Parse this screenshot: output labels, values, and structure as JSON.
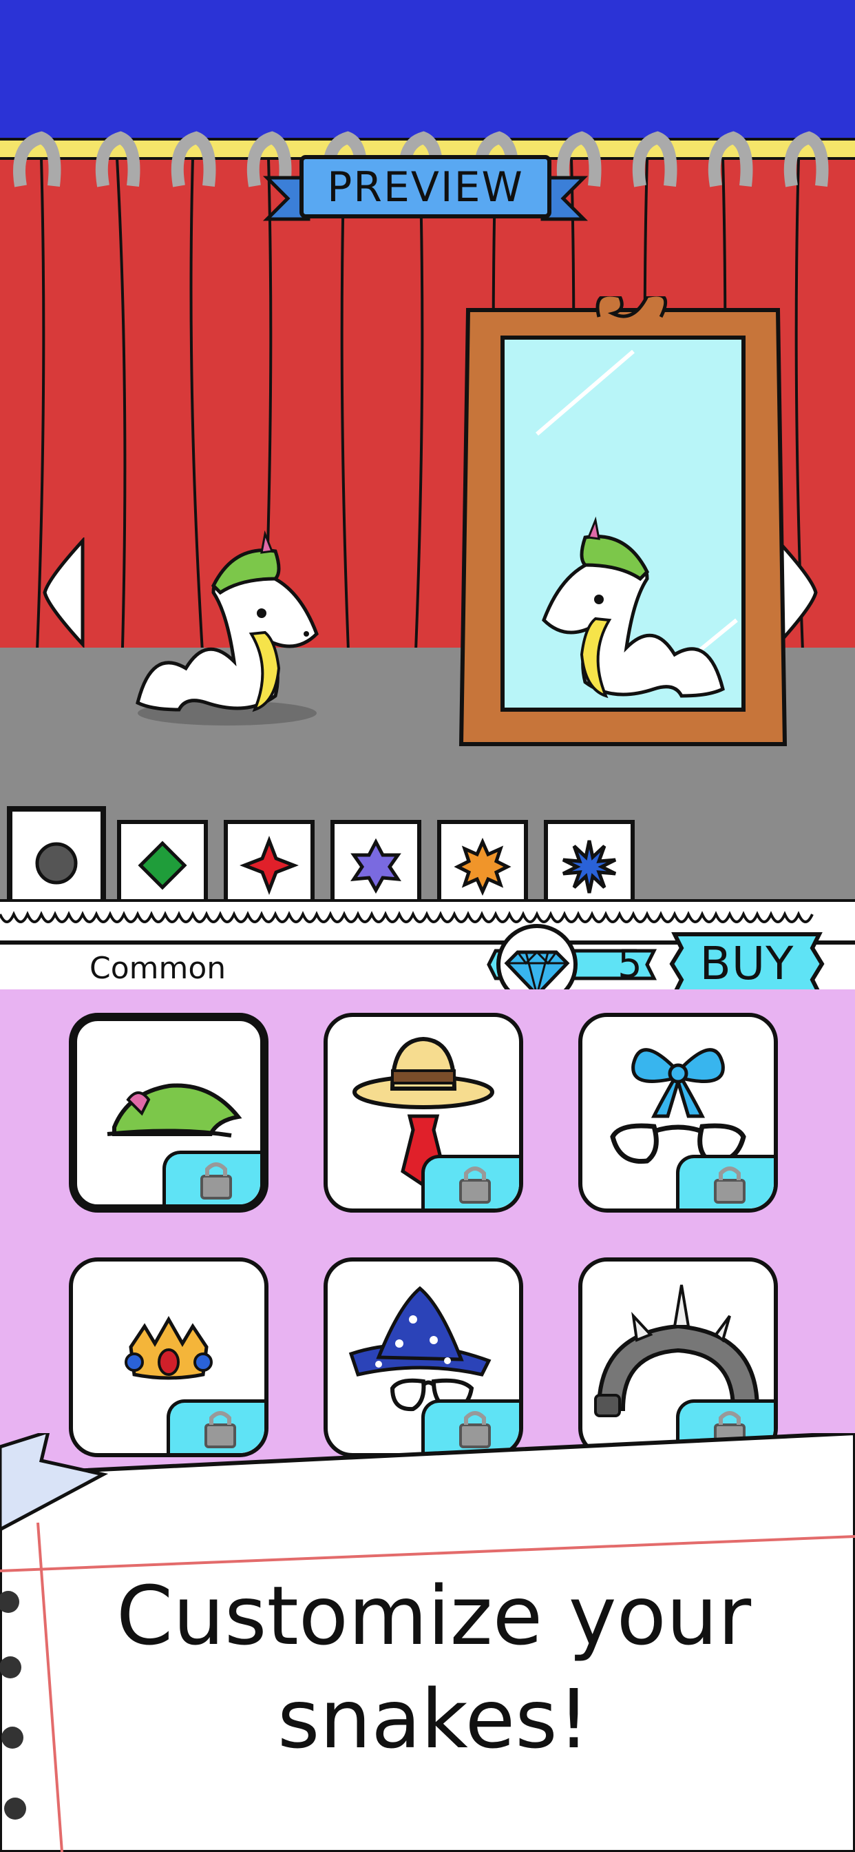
{
  "preview": {
    "title": "PREVIEW"
  },
  "rarity_tabs": [
    {
      "name": "circle",
      "color": "#555555"
    },
    {
      "name": "diamond",
      "color": "#1f9d3a"
    },
    {
      "name": "star4",
      "color": "#e0202a"
    },
    {
      "name": "star6",
      "color": "#7a6ae0"
    },
    {
      "name": "star8",
      "color": "#f0952a"
    },
    {
      "name": "star12",
      "color": "#2a62d8"
    }
  ],
  "shop": {
    "rarity_label": "Common",
    "price": "5",
    "currency_icon": "diamond-gem-icon",
    "buy_label": "BUY"
  },
  "items": [
    {
      "name": "green-feather-hat",
      "locked": true
    },
    {
      "name": "straw-hat-and-tie",
      "locked": true
    },
    {
      "name": "blue-bow-and-glasses",
      "locked": true
    },
    {
      "name": "small-crown",
      "locked": true
    },
    {
      "name": "wizard-hat-and-glasses",
      "locked": true
    },
    {
      "name": "spiked-headband",
      "locked": true
    }
  ],
  "headline": {
    "line1": "Customize your",
    "line2": "snakes!"
  },
  "colors": {
    "sky": "#2b33d6",
    "curtain": "#d83a3a",
    "stage": "#8b8b8b",
    "grid_bg": "#e8b3f2",
    "lock_bg": "#5fe3f5",
    "banner": "#59a8f2"
  }
}
